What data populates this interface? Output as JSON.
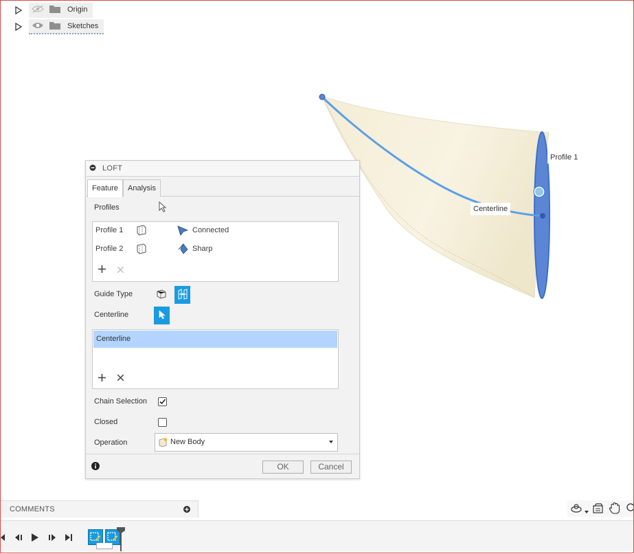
{
  "browser": {
    "items": [
      {
        "label": "Origin",
        "visibility_icon": "eye-hidden-icon"
      },
      {
        "label": "Sketches",
        "visibility_icon": "eye-icon"
      }
    ]
  },
  "viewport": {
    "profile_label": "Profile 1",
    "centerline_label": "Centerline"
  },
  "loft": {
    "title": "LOFT",
    "tabs": [
      {
        "label": "Feature"
      },
      {
        "label": "Analysis"
      }
    ],
    "profiles_label": "Profiles",
    "profiles": [
      {
        "name": "Profile 1",
        "condition": "Connected"
      },
      {
        "name": "Profile 2",
        "condition": "Sharp"
      }
    ],
    "guide_type_label": "Guide Type",
    "centerline_label": "Centerline",
    "centerline_items": [
      "Centerline"
    ],
    "chain_selection_label": "Chain Selection",
    "chain_selection_checked": true,
    "closed_label": "Closed",
    "closed_checked": false,
    "operation_label": "Operation",
    "operation_value": "New Body",
    "ok_label": "OK",
    "cancel_label": "Cancel"
  },
  "comments": {
    "label": "COMMENTS"
  },
  "colors": {
    "accent": "#1a9be0",
    "selection": "#b3d4ff",
    "curve": "#5aa0e6",
    "surface": "#f7f1dc"
  }
}
